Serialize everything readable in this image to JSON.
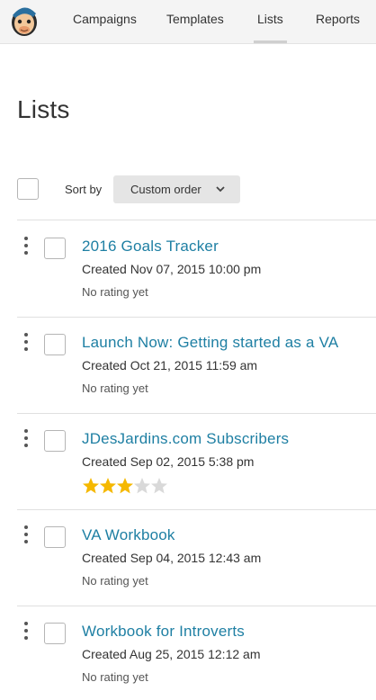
{
  "nav": {
    "items": [
      {
        "label": "Campaigns",
        "active": false
      },
      {
        "label": "Templates",
        "active": false
      },
      {
        "label": "Lists",
        "active": true
      },
      {
        "label": "Reports",
        "active": false
      }
    ]
  },
  "page": {
    "title": "Lists"
  },
  "sort": {
    "label": "Sort by",
    "value": "Custom order"
  },
  "lists": [
    {
      "title": "2016 Goals Tracker",
      "created": "Created Nov 07, 2015 10:00 pm",
      "rating_text": "No rating yet",
      "stars": null
    },
    {
      "title": "Launch Now: Getting started as a VA",
      "created": "Created Oct 21, 2015 11:59 am",
      "rating_text": "No rating yet",
      "stars": null
    },
    {
      "title": "JDesJardins.com Subscribers",
      "created": "Created Sep 02, 2015 5:38 pm",
      "rating_text": null,
      "stars": 3,
      "stars_max": 5
    },
    {
      "title": "VA Workbook",
      "created": "Created Sep 04, 2015 12:43 am",
      "rating_text": "No rating yet",
      "stars": null
    },
    {
      "title": "Workbook for Introverts",
      "created": "Created Aug 25, 2015 12:12 am",
      "rating_text": "No rating yet",
      "stars": null
    }
  ],
  "colors": {
    "link": "#1e7fa3",
    "star_filled": "#f5b800",
    "star_empty": "#d9d9d9"
  }
}
